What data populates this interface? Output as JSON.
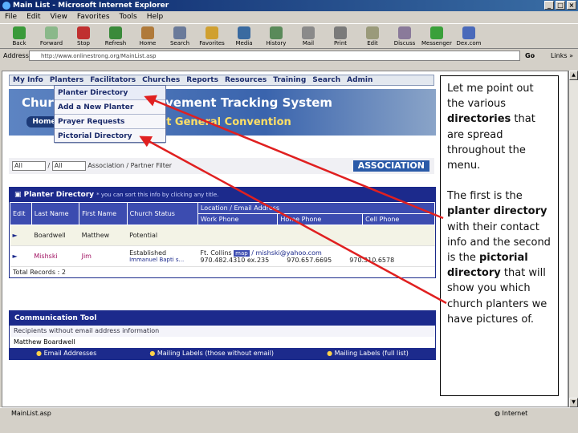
{
  "window": {
    "title": "Main List - Microsoft Internet Explorer"
  },
  "menubar": [
    "File",
    "Edit",
    "View",
    "Favorites",
    "Tools",
    "Help"
  ],
  "toolbar": [
    "Back",
    "Forward",
    "Stop",
    "Refresh",
    "Home",
    "Search",
    "Favorites",
    "Media",
    "History",
    "Mail",
    "Print",
    "Edit",
    "Discuss",
    "Messenger",
    "Dex.com"
  ],
  "address": {
    "label": "Address",
    "url": "http://www.onlinestrong.org/MainList.asp",
    "go": "Go",
    "links": "Links »"
  },
  "nav": [
    "My Info",
    "Planters",
    "Facilitators",
    "Churches",
    "Reports",
    "Resources",
    "Training",
    "Search",
    "Admin"
  ],
  "banner": {
    "title_left": "Chur",
    "title_right": "vement Tracking System",
    "subtitle": "ist General Convention",
    "home": "Home"
  },
  "dropdown": [
    "Planter Directory",
    "Add a New Planter",
    "Prayer Requests",
    "Pictorial Directory"
  ],
  "filter": {
    "select1": "All",
    "select2": "All",
    "label": "Association / Partner Filter",
    "assoc": "ASSOCIATION"
  },
  "planter_panel": {
    "title": "Planter Directory",
    "subtitle": "* you can sort this info by clicking any title.",
    "headers": [
      "Edit",
      "Last Name",
      "First Name",
      "Church Status",
      "Location / Email Address",
      "Work Phone",
      "Home Phone",
      "Cell Phone"
    ],
    "rows": [
      {
        "edit": "►",
        "last": "Boardwell",
        "first": "Matthew",
        "status": "Potential",
        "location": "",
        "work": "",
        "home": "",
        "cell": ""
      },
      {
        "edit": "►",
        "last": "Mishski",
        "first": "Jim",
        "status": "Established",
        "church": "Immanuel Bapti s...",
        "location": "Ft. Collins",
        "map": "map",
        "email": "/ mishski@yahoo.com",
        "work": "970.482.4310 ex.235",
        "home": "970.657.6695",
        "cell": "970.310.6578"
      }
    ],
    "totals": "Total Records : 2"
  },
  "comm_panel": {
    "title": "Communication Tool",
    "subtitle": "Recipients without email address information",
    "name": "Matthew Boardwell",
    "links": [
      "Email Addresses",
      "Mailing Labels (those without email)",
      "Mailing Labels (full list)"
    ]
  },
  "status": {
    "left": "MainList.asp",
    "zone": "Internet"
  },
  "callout": {
    "p1_pre": "Let me point out the various ",
    "p1_bold": "directories",
    "p1_post": " that are spread throughout the menu.",
    "p2_pre": "The first is the ",
    "p2_bold1": "planter directory",
    "p2_mid": " with their contact info and the second is the ",
    "p2_bold2": "pictorial directory",
    "p2_post": " that will show you which church planters we have pictures of."
  },
  "colors": {
    "accent": "#1c2a8c",
    "arrow": "#e02020"
  }
}
